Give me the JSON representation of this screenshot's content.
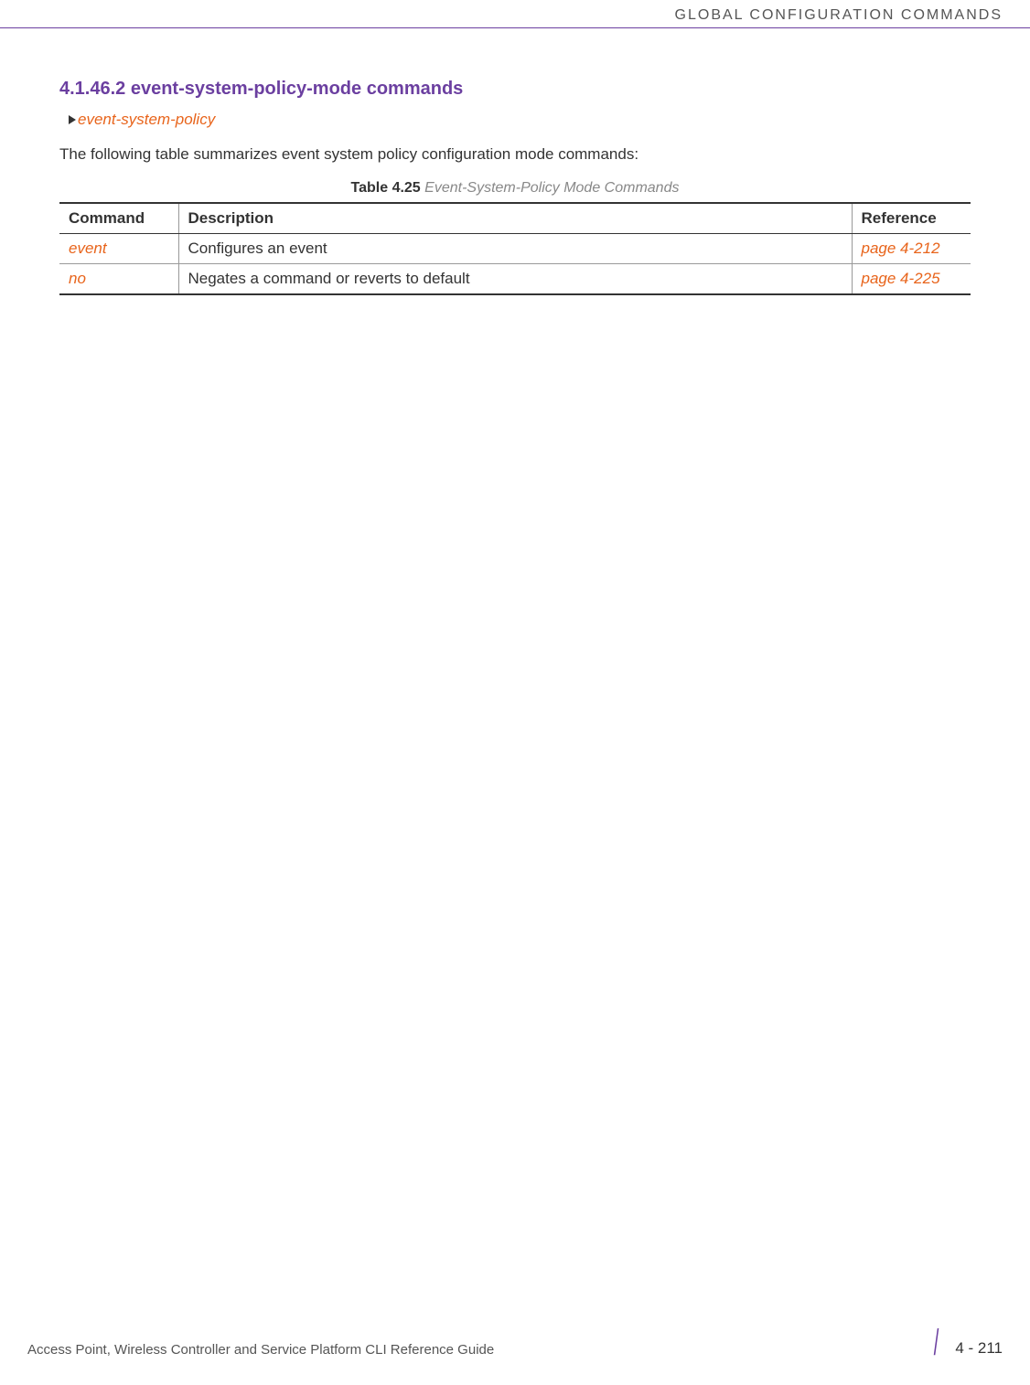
{
  "header": {
    "chapter_title": "GLOBAL CONFIGURATION COMMANDS"
  },
  "section": {
    "heading": "4.1.46.2 event-system-policy-mode commands",
    "parent_link": "event-system-policy",
    "intro_text": "The following table summarizes event system policy configuration mode commands:",
    "table_caption_label": "Table 4.25",
    "table_caption_title": "Event-System-Policy Mode Commands"
  },
  "table": {
    "headers": {
      "command": "Command",
      "description": "Description",
      "reference": "Reference"
    },
    "rows": [
      {
        "command": "event",
        "description": "Configures an event",
        "reference": "page 4-212"
      },
      {
        "command": "no",
        "description": "Negates a command or reverts to default",
        "reference": "page 4-225"
      }
    ]
  },
  "footer": {
    "guide_title": "Access Point, Wireless Controller and Service Platform CLI Reference Guide",
    "page_number": "4 - 211"
  }
}
